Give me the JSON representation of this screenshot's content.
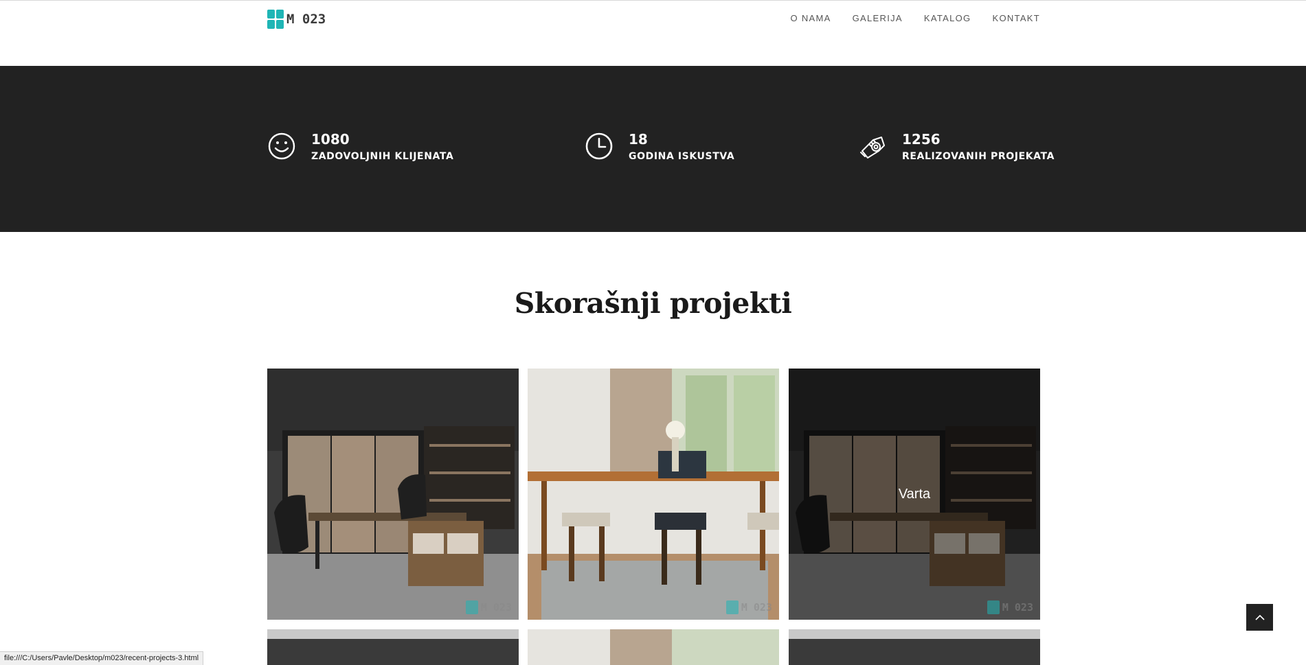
{
  "header": {
    "logo_text": "M 023",
    "nav": [
      "O NAMA",
      "GALERIJA",
      "KATALOG",
      "KONTAKT"
    ]
  },
  "stats": [
    {
      "icon": "smiley-icon",
      "value": "1080",
      "label": "ZADOVOLJNIH KLIJENATA"
    },
    {
      "icon": "clock-icon",
      "value": "18",
      "label": "GODINA ISKUSTVA"
    },
    {
      "icon": "measuring-tape-icon",
      "value": "1256",
      "label": "REALIZOVANIH PROJEKATA"
    }
  ],
  "projects": {
    "title": "Skorašnji projekti",
    "hovered_caption": "Varta",
    "watermark": "M 023"
  },
  "status_bar": {
    "url": "file:///C:/Users/Pavle/Desktop/m023/recent-projects-3.html"
  },
  "colors": {
    "accent": "#1fb5b5",
    "dark_band": "#222222",
    "background": "#ffffff"
  }
}
